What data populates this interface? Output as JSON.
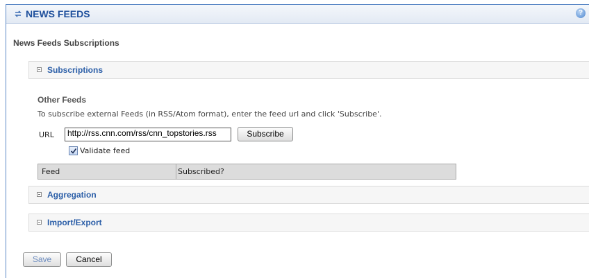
{
  "header": {
    "title": "NEWS FEEDS",
    "icon": "refresh-arrows-icon",
    "help_icon": "help-icon",
    "help_glyph": "?"
  },
  "page": {
    "section_title": "News Feeds Subscriptions"
  },
  "panels": [
    {
      "label": "Subscriptions",
      "state": "expanded"
    },
    {
      "label": "Aggregation",
      "state": "collapsed"
    },
    {
      "label": "Import/Export",
      "state": "collapsed"
    }
  ],
  "subscriptions": {
    "subsection_title": "Other Feeds",
    "instructions": "To subscribe external Feeds (in RSS/Atom format), enter the feed url and click 'Subscribe'.",
    "url_label": "URL",
    "url_value": "http://rss.cnn.com/rss/cnn_topstories.rss",
    "subscribe_label": "Subscribe",
    "validate_label": "Validate feed",
    "validate_checked": true,
    "table_headers": [
      "Feed",
      "Subscribed?"
    ]
  },
  "footer": {
    "save_label": "Save",
    "cancel_label": "Cancel"
  },
  "colors": {
    "accent": "#1e4f9c",
    "panel_link": "#2c5fa8",
    "frame_border": "#5a87c5"
  }
}
